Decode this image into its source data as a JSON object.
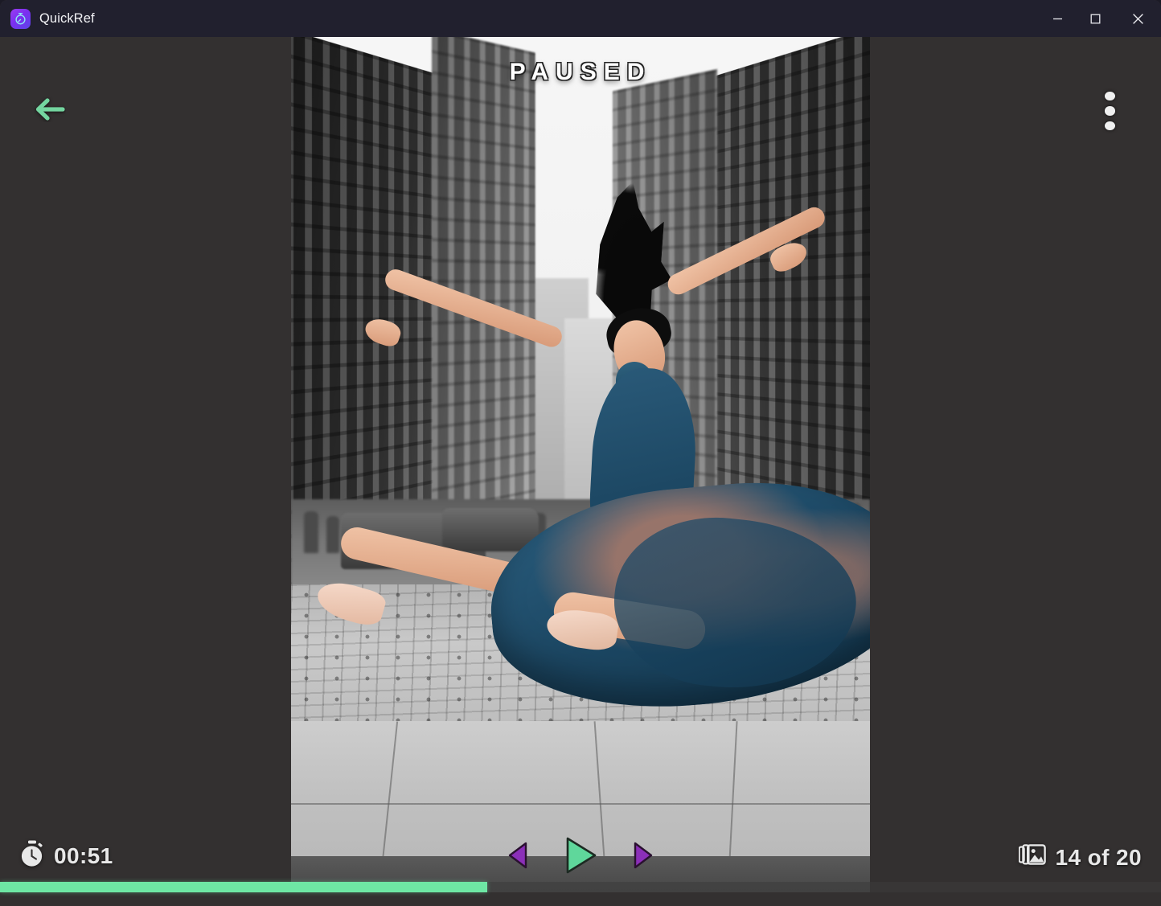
{
  "window": {
    "title": "QuickRef",
    "app_icon": "stopwatch-app-icon",
    "background_color": "#333030",
    "titlebar_color": "#21202e",
    "controls": {
      "minimize_label": "Minimize",
      "maximize_label": "Maximize",
      "close_label": "Close"
    }
  },
  "viewer": {
    "status_text": "PAUSED",
    "back_label": "Back",
    "back_icon": "arrow-left-icon",
    "back_color": "#74d6a0",
    "menu_label": "More options",
    "menu_icon": "more-vertical-icon",
    "image_alt": "Ballet dancer leaping on a city street, selective color"
  },
  "timer": {
    "icon": "stopwatch-icon",
    "elapsed": "00:51"
  },
  "counter": {
    "icon": "image-stack-icon",
    "text": "14 of 20",
    "current": 14,
    "total": 20
  },
  "transport": {
    "previous_label": "Previous image",
    "previous_icon": "triangle-left-icon",
    "play_label": "Play",
    "play_icon": "triangle-right-play-icon",
    "next_label": "Next image",
    "next_icon": "triangle-right-icon",
    "accent_color": "#8b2fb8",
    "play_color": "#5fd79b"
  },
  "progress": {
    "percent": 42,
    "fill_color": "#6ee7a4",
    "track_color": "#3c3c3c"
  }
}
